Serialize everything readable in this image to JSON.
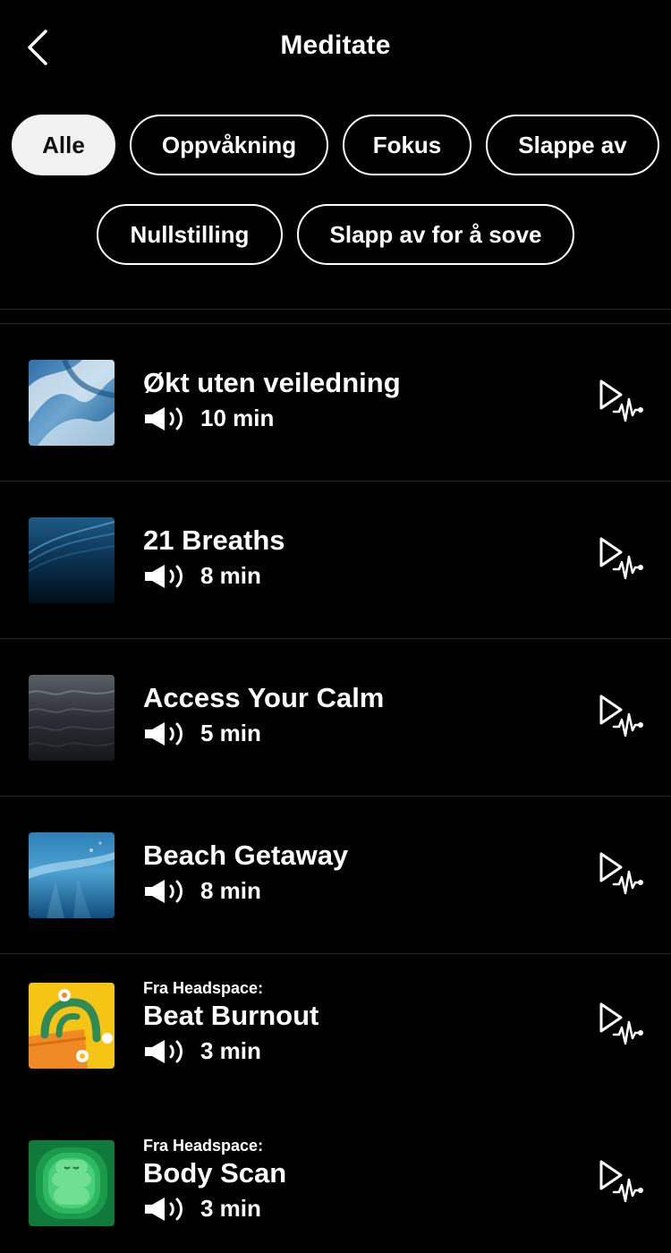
{
  "header": {
    "title": "Meditate",
    "back_icon": "chevron-left-icon"
  },
  "filters": [
    {
      "label": "Alle",
      "active": true
    },
    {
      "label": "Oppvåkning",
      "active": false
    },
    {
      "label": "Fokus",
      "active": false
    },
    {
      "label": "Slappe av",
      "active": false
    },
    {
      "label": "Nullstilling",
      "active": false
    },
    {
      "label": "Slapp av for å sove",
      "active": false
    }
  ],
  "sessions": [
    {
      "title": "Økt uten veiledning",
      "duration": "10 min",
      "from": "",
      "thumb": "wave-sky-image",
      "audio_icon": "speaker-icon",
      "action_icon": "play-audio-icon"
    },
    {
      "title": "21 Breaths",
      "duration": "8 min",
      "from": "",
      "thumb": "dark-ocean-image",
      "audio_icon": "speaker-icon",
      "action_icon": "play-audio-icon"
    },
    {
      "title": "Access Your Calm",
      "duration": "5 min",
      "from": "",
      "thumb": "grey-sea-image",
      "audio_icon": "speaker-icon",
      "action_icon": "play-audio-icon"
    },
    {
      "title": "Beach Getaway",
      "duration": "8 min",
      "from": "",
      "thumb": "underwater-image",
      "audio_icon": "speaker-icon",
      "action_icon": "play-audio-icon"
    },
    {
      "title": "Beat Burnout",
      "duration": "3 min",
      "from": "Fra Headspace:",
      "thumb": "flower-pot-illustration",
      "audio_icon": "speaker-icon",
      "action_icon": "play-audio-icon"
    },
    {
      "title": "Body Scan",
      "duration": "3 min",
      "from": "Fra Headspace:",
      "thumb": "green-character-illustration",
      "audio_icon": "speaker-icon",
      "action_icon": "play-audio-icon"
    }
  ],
  "colors": {
    "background": "#000000",
    "text": "#ffffff",
    "chip_active_bg": "#f2f2f2",
    "chip_active_text": "#111111",
    "divider": "#2b2b2b"
  }
}
